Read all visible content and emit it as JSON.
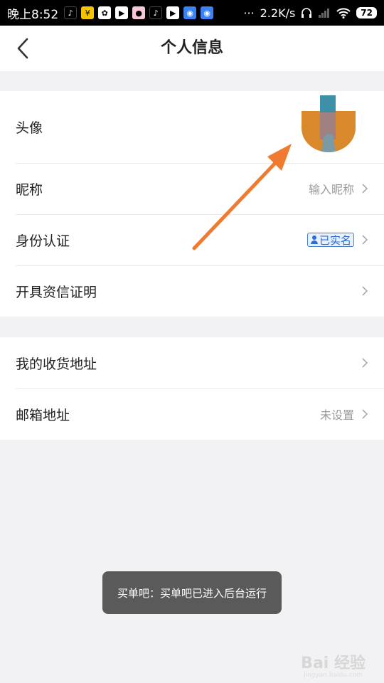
{
  "status_bar": {
    "time": "晚上8:52",
    "dots": "···",
    "net_speed": "2.2K/s",
    "battery": "72"
  },
  "header": {
    "title": "个人信息"
  },
  "profile": {
    "avatar_label": "头像",
    "nickname_label": "昵称",
    "nickname_placeholder": "输入昵称",
    "identity_label": "身份认证",
    "identity_status": "已实名",
    "credit_label": "开具资信证明"
  },
  "address": {
    "shipping_label": "我的收货地址",
    "email_label": "邮箱地址",
    "email_value": "未设置"
  },
  "toast": {
    "text": "买单吧：买单吧已进入后台运行"
  },
  "watermark": {
    "text": "Bai 经验",
    "sub": "jingyan.baidu.com"
  },
  "colors": {
    "accent_arrow": "#f07a2f",
    "verified_blue": "#2e6bd6"
  }
}
